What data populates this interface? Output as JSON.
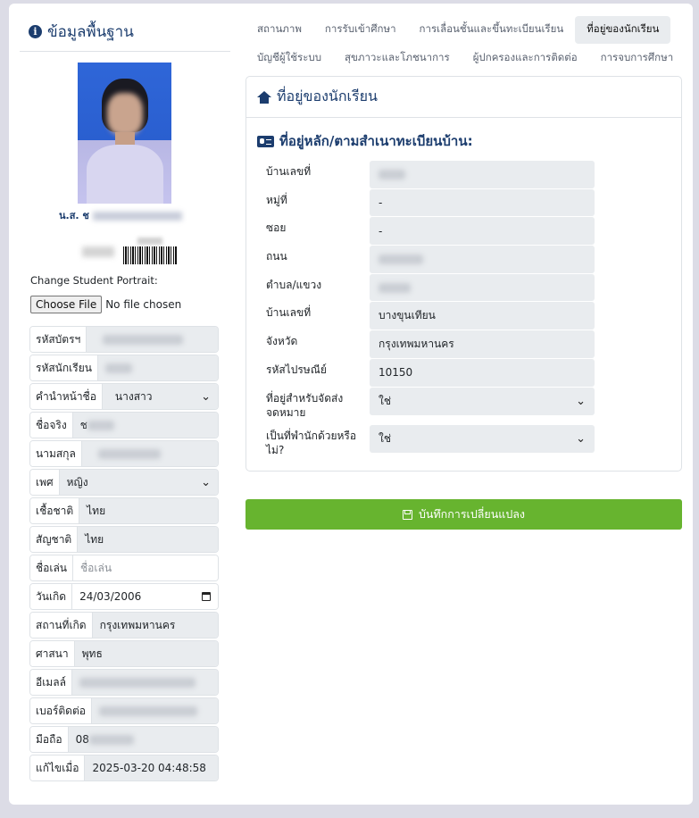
{
  "basic_info": {
    "title": "ข้อมูลพื้นฐาน",
    "student_name_prefix": "น.ส. ช",
    "portrait_label": "Change Student Portrait:",
    "file_button": "Choose File",
    "file_status": "No file chosen",
    "fields": [
      {
        "label": "รหัสบัตรฯ",
        "value": ""
      },
      {
        "label": "รหัสนักเรียน",
        "value": ""
      },
      {
        "label": "คำนำหน้าชื่อ",
        "value": "นางสาว",
        "type": "select"
      },
      {
        "label": "ชื่อจริง",
        "value": "ช"
      },
      {
        "label": "นามสกุล",
        "value": ""
      },
      {
        "label": "เพศ",
        "value": "หญิง",
        "type": "select"
      },
      {
        "label": "เชื้อชาติ",
        "value": "ไทย"
      },
      {
        "label": "สัญชาติ",
        "value": "ไทย"
      },
      {
        "label": "ชื่อเล่น",
        "placeholder": "ชื่อเล่น"
      },
      {
        "label": "วันเกิด",
        "value": "24/03/2006",
        "type": "date"
      },
      {
        "label": "สถานที่เกิด",
        "value": "กรุงเทพมหานคร"
      },
      {
        "label": "ศาสนา",
        "value": "พุทธ"
      },
      {
        "label": "อีเมลล์",
        "value": ""
      },
      {
        "label": "เบอร์ติดต่อ",
        "value": ""
      },
      {
        "label": "มือถือ",
        "value": "08"
      },
      {
        "label": "แก้ไขเมื่อ",
        "value": "2025-03-20 04:48:58"
      }
    ]
  },
  "tabs": {
    "row1": [
      "สถานภาพ",
      "การรับเข้าศึกษา",
      "การเลื่อนชั้นและขึ้นทะเบียนเรียน",
      "ที่อยู่ของนักเรียน"
    ],
    "row2": [
      "บัญชีผู้ใช้ระบบ",
      "สุขภาวะและโภชนาการ",
      "ผู้ปกครองและการติดต่อ",
      "การจบการศึกษา"
    ],
    "active": "ที่อยู่ของนักเรียน"
  },
  "address_panel": {
    "title": "ที่อยู่ของนักเรียน",
    "subtitle": "ที่อยู่หลัก/ตามสำเนาทะเบียนบ้าน:",
    "rows": [
      {
        "label": "บ้านเลขที่",
        "value": ""
      },
      {
        "label": "หมู่ที่",
        "value": "-"
      },
      {
        "label": "ซอย",
        "value": "-"
      },
      {
        "label": "ถนน",
        "value": ""
      },
      {
        "label": "ตำบล/แขวง",
        "value": ""
      },
      {
        "label": "บ้านเลขที่",
        "value": "บางขุนเทียน"
      },
      {
        "label": "จังหวัด",
        "value": "กรุงเทพมหานคร"
      },
      {
        "label": "รหัสไปรษณีย์",
        "value": "10150"
      },
      {
        "label": "ที่อยู่สำหรับจัดส่งจดหมาย",
        "value": "ใช่",
        "type": "select"
      },
      {
        "label": "เป็นที่พำนักด้วยหรือไม่?",
        "value": "ใช่",
        "type": "select"
      }
    ]
  },
  "save_button": "บันทึกการเปลี่ยนแปลง",
  "colors": {
    "accent": "#1c3d6e",
    "save": "#67b42f",
    "field_bg": "#e9ecef"
  }
}
